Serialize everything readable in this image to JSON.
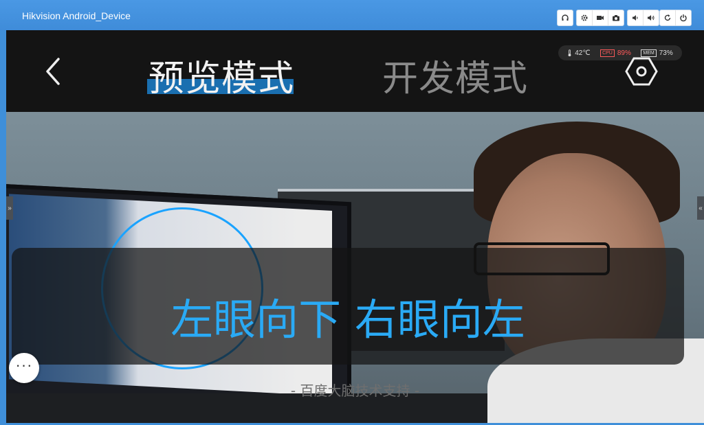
{
  "window": {
    "title": "Hikvision Android_Device",
    "toolbar_icons": [
      "headphones-icon",
      "gear-icon",
      "video-camera-icon",
      "camera-icon",
      "volume-down-icon",
      "volume-up-icon",
      "refresh-icon",
      "power-icon"
    ]
  },
  "header": {
    "tabs": [
      {
        "label": "预览模式",
        "active": true
      },
      {
        "label": "开发模式",
        "active": false
      }
    ],
    "accent": "#1a6fb0"
  },
  "status": {
    "temperature": "42℃",
    "cpu_label": "CPU",
    "cpu": "89%",
    "mem_label": "MEM",
    "mem": "73%"
  },
  "preview": {
    "instruction": "左眼向下 右眼向左",
    "footer": "- 百度大脑技术支持 -",
    "instruction_color": "#2aaaf5"
  },
  "more_button": "···",
  "handles": {
    "left": "»",
    "right": "«"
  }
}
